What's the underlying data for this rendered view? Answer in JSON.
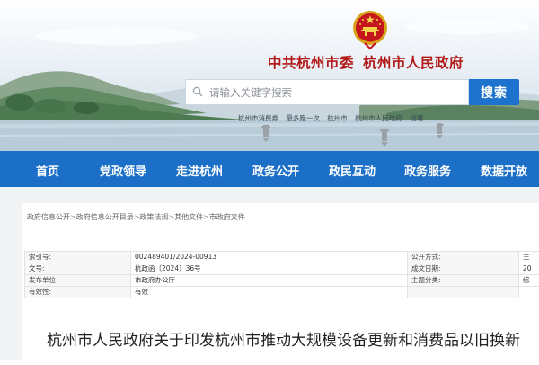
{
  "header": {
    "site_title_left": "中共杭州市委",
    "site_title_right": "杭州市人民政府",
    "emblem_icon": "national-emblem-icon",
    "search": {
      "placeholder": "请输入关键字搜索",
      "button_label": "搜索"
    },
    "hot_words": [
      "杭州市消费券",
      "最多跑一次",
      "杭州市",
      "杭州市人民政府",
      "钱塘"
    ]
  },
  "nav": {
    "items": [
      "首页",
      "党政领导",
      "走进杭州",
      "政务公开",
      "政民互动",
      "政务服务",
      "数据开放"
    ],
    "bg_color": "#1b6fc6"
  },
  "breadcrumb": [
    "政府信息公开",
    "政府信息公开目录",
    "政策法规",
    "其他文件",
    "市政府文件"
  ],
  "meta": {
    "rows": [
      {
        "label": "索引号:",
        "value": "002489401/2024-00913",
        "label2": "公开方式:",
        "value2": "主"
      },
      {
        "label": "文号:",
        "value": "杭政函〔2024〕36号",
        "label2": "成文日期:",
        "value2": "20"
      },
      {
        "label": "发布单位:",
        "value": "市政府办公厅",
        "label2": "主题分类:",
        "value2": "综"
      },
      {
        "label": "有效性:",
        "value": "有效",
        "label2": "",
        "value2": ""
      }
    ]
  },
  "document": {
    "title": "杭州市人民政府关于印发杭州市推动大规模设备更新和消费品以旧换新"
  },
  "colors": {
    "accent": "#1b6fc6",
    "title_red": "#b11a18",
    "search_button": "#1c72cd"
  }
}
